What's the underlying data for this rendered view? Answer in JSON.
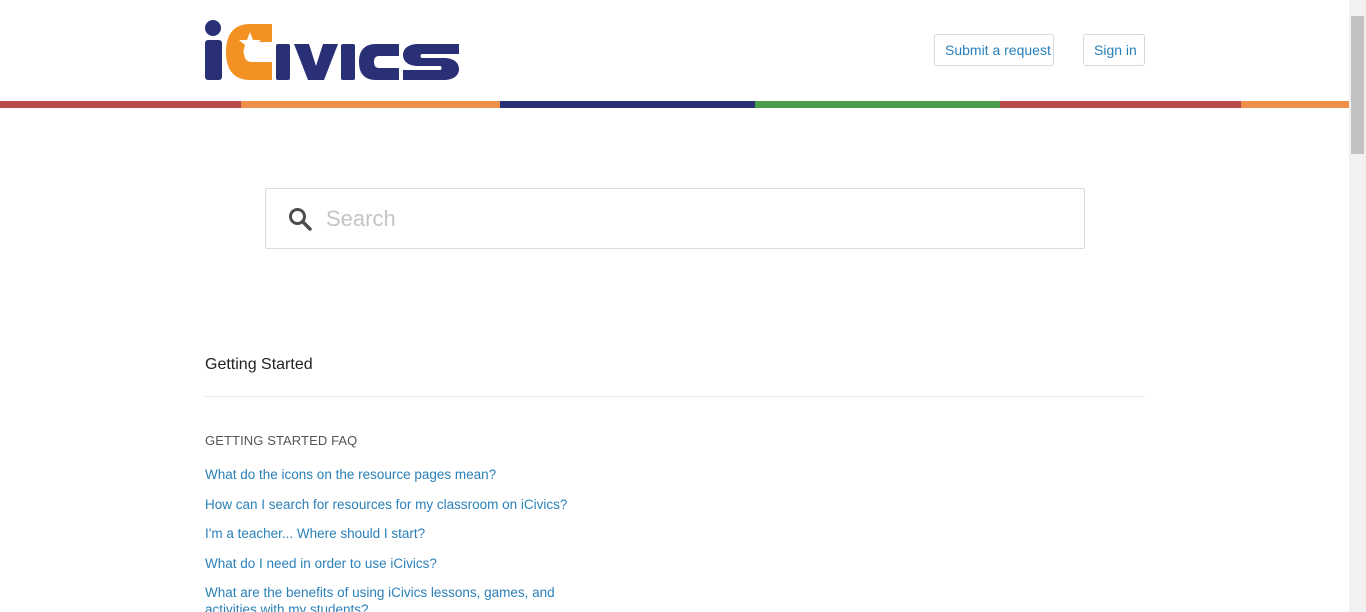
{
  "header": {
    "logo_alt": "iCivics",
    "submit_request_label": "Submit a request",
    "sign_in_label": "Sign in"
  },
  "stripe_colors": [
    "#b94a4a",
    "#ee8f4a",
    "#2a3076",
    "#4a9b4a",
    "#b94a4a",
    "#ee8f4a"
  ],
  "brand_colors": {
    "navy": "#2a3076",
    "orange": "#f39223",
    "link": "#2a80b9"
  },
  "search": {
    "placeholder": "Search",
    "icon": "search-icon"
  },
  "section": {
    "title": "Getting Started",
    "subsection_title": "GETTING STARTED FAQ",
    "articles": [
      "What do the icons on the resource pages mean?",
      "How can I search for resources for my classroom on iCivics?",
      "I'm a teacher... Where should I start?",
      "What do I need in order to use iCivics?",
      "What are the benefits of using iCivics lessons, games, and activities with my students?"
    ]
  }
}
